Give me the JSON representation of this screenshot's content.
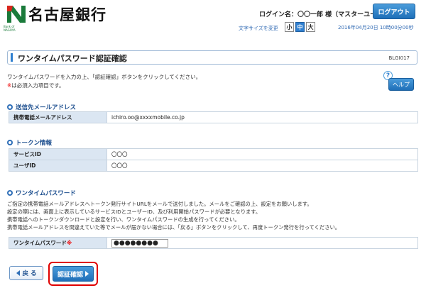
{
  "header": {
    "bank_name": "名古屋銀行",
    "logo_sub": "Bank of\nNAGOYA",
    "login_label": "ログイン名：〇〇一郎 様（マスターユーザー）",
    "logout_label": "ログアウト",
    "font_size_label": "文字サイズを変更",
    "font_sizes": [
      "小",
      "中",
      "大"
    ],
    "datetime": "2016年04月20日 10時00分00秒",
    "logo_color": "#1a7a3a"
  },
  "page": {
    "title": "ワンタイムパスワード認証確認",
    "screen_id": "BLGI017",
    "intro_line1": "ワンタイムパスワードを入力の上、「認証確認」ボタンをクリックしてください。",
    "intro_req_mark": "※",
    "intro_line2": "は必須入力項目です。",
    "help_mark": "?",
    "help_label": "ヘルプ"
  },
  "email_section": {
    "title": "送信先メールアドレス",
    "rows": [
      {
        "label": "携帯電話メールアドレス",
        "value": "ichiro.oo@xxxxmobile.co.jp"
      }
    ]
  },
  "token_section": {
    "title": "トークン情報",
    "rows": [
      {
        "label": "サービスID",
        "value": "〇〇〇"
      },
      {
        "label": "ユーザID",
        "value": "〇〇〇"
      }
    ]
  },
  "otp_section": {
    "title": "ワンタイムパスワード",
    "desc": [
      "ご指定の携帯電話メールアドレスへトークン発行サイトURLをメールで送付しました。メールをご確認の上、設定をお願いします。",
      "設定の際には、画面上に表示しているサービスIDとユーザーID、及び利用開始パスワードが必要となります。",
      "携帯電話へのトークンダウンロードと設定を行い、ワンタイムパスワードの生成を行ってください。",
      "携帯電話メールアドレスを間違えていた等でメールが届かない場合には、「戻る」ボタンをクリックして、再度トークン発行を行ってください。"
    ],
    "field_label": "ワンタイムパスワード",
    "required_mark": "※",
    "field_value": "●●●●●●●●"
  },
  "buttons": {
    "back_label": "戻 る",
    "confirm_label": "認証確認"
  },
  "colors": {
    "accent": "#2f7fd0",
    "header_row": "#dbe6f2",
    "highlight": "#e00000"
  }
}
